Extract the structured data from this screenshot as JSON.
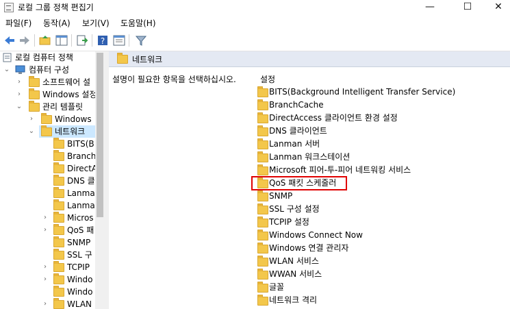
{
  "window": {
    "title": "로컬 그룹 정책 편집기",
    "minimize": "—",
    "maximize": "☐",
    "close": "✕"
  },
  "menu": [
    "파일(F)",
    "동작(A)",
    "보기(V)",
    "도움말(H)"
  ],
  "tree": {
    "root": "로컬 컴퓨터 정책",
    "computer_config": "컴퓨터 구성",
    "items": [
      {
        "label": "소프트웨어 설"
      },
      {
        "label": "Windows 설정"
      },
      {
        "label": "관리 템플릿"
      },
      {
        "label": "Windows"
      },
      {
        "label": "네트워크"
      },
      {
        "label": "BITS(B"
      },
      {
        "label": "Branch"
      },
      {
        "label": "DirectA"
      },
      {
        "label": "DNS 클"
      },
      {
        "label": "Lanma"
      },
      {
        "label": "Lanma"
      },
      {
        "label": "Micros"
      },
      {
        "label": "QoS 패"
      },
      {
        "label": "SNMP"
      },
      {
        "label": "SSL 구"
      },
      {
        "label": "TCPIP"
      },
      {
        "label": "Windo"
      },
      {
        "label": "Windo"
      },
      {
        "label": "WLAN"
      }
    ]
  },
  "right": {
    "header": "네트워크",
    "description": "설명이 필요한 항목을 선택하십시오.",
    "column": "설정",
    "items": [
      "BITS(Background Intelligent Transfer Service)",
      "BranchCache",
      "DirectAccess 클라이언트 환경 설정",
      "DNS 클라이언트",
      "Lanman 서버",
      "Lanman 워크스테이션",
      "Microsoft 피어-투-피어 네트워킹 서비스",
      "QoS 패킷 스케줄러",
      "SNMP",
      "SSL 구성 설정",
      "TCPIP 설정",
      "Windows Connect Now",
      "Windows 연결 관리자",
      "WLAN 서비스",
      "WWAN 서비스",
      "글꼴",
      "네트워크 격리"
    ],
    "highlighted_item": "QoS 패킷 스케줄러"
  },
  "colors": {
    "highlight": "#e00000",
    "selection": "#cce8ff",
    "folder": "#f3c74b",
    "header_bg": "#e4e9f3"
  }
}
